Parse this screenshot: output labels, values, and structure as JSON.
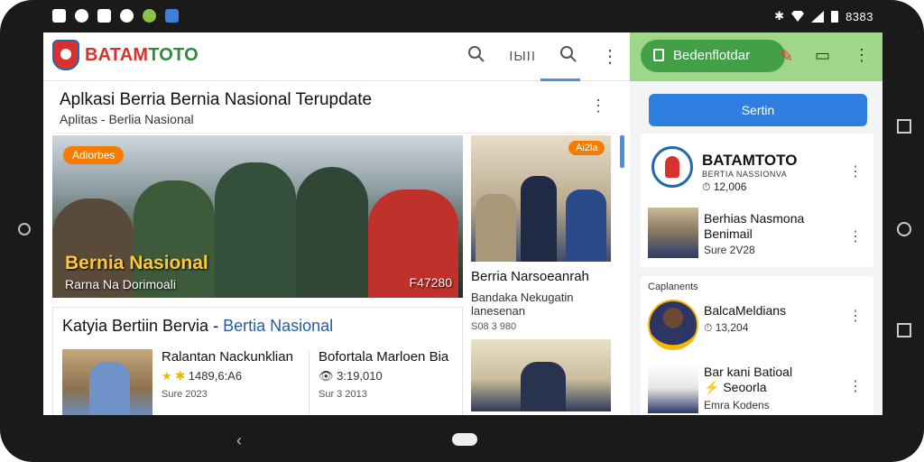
{
  "status_bar": {
    "time": "8383"
  },
  "app": {
    "logo_main": "BATAM",
    "logo_accent": "TOTO",
    "top_icon_text": "IЫII"
  },
  "right_header": {
    "pill_label": "Bedenflotdar"
  },
  "headline": {
    "title": "Aplkasi Berria Bernia Nasional Terupdate",
    "subtitle": "Aplitas - Berlia Nasional"
  },
  "hero": {
    "badge": "Adiorbes",
    "title": "Bernia Nasional",
    "subtitle": "Rarna Na Dorimoali",
    "date": "F47280"
  },
  "side_story": {
    "badge": "Ai2la",
    "title": "Berria Narsoeanrah",
    "description_line1": "Bandaka Nekugatin",
    "description_line2": "lanesenan",
    "date": "S08 3 980"
  },
  "category": {
    "title_main": "Katyia Bertiin Bervia - ",
    "title_accent": "Bertia Nasional",
    "items": [
      {
        "title": "Ralantan Nackunklian",
        "meta": "1489,6:A6",
        "date": "Sure 2023"
      },
      {
        "title": "Bofortala Marloen Bia",
        "meta": "3:19,010",
        "date": "Sur 3 2013"
      }
    ]
  },
  "sidebar": {
    "search_label": "Sertin",
    "brand_title": "BATAMTOTO",
    "brand_sub": "BERTIA NASSIONVA",
    "brand_count": "12,006",
    "story_title_1": "Berhias Nasmona",
    "story_title_2": "Benimail",
    "story_meta": "Sure 2V28",
    "section_label": "Caplanents",
    "list": [
      {
        "title": "BalcaMeldians",
        "meta": "13,204"
      },
      {
        "title": "Bar kani Batioal",
        "subtitle": "Seoorla",
        "meta": "Emra Kodens"
      }
    ]
  },
  "colors": {
    "accent_blue": "#2f7fe0",
    "brand_red": "#d8322e",
    "brand_green": "#2e8b3e",
    "badge_orange": "#f57c00",
    "header_green": "#9fd68a"
  }
}
